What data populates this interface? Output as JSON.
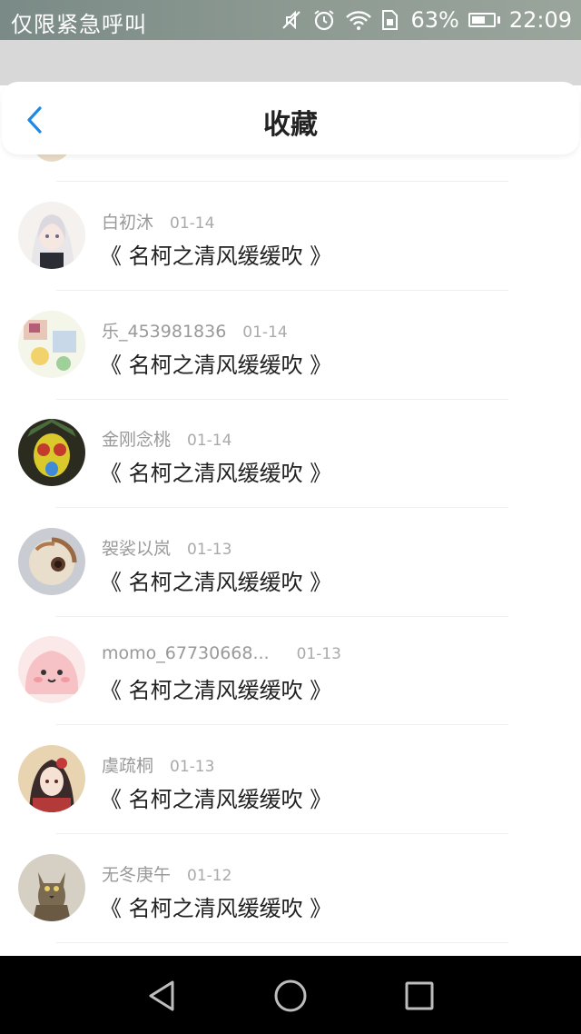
{
  "status_bar": {
    "carrier": "仅限紧急呼叫",
    "battery": "63%",
    "battery_level": 0.63,
    "time": "22:09",
    "icons": [
      "mute-icon",
      "alarm-icon",
      "wifi-icon",
      "sim-icon",
      "battery-icon"
    ]
  },
  "header": {
    "title": "收藏",
    "back_icon": "chevron-left-icon",
    "accent": "#1e88e5"
  },
  "favorites": [
    {
      "user": "白初沐",
      "date": "01-14",
      "work": "《 名柯之清风缓缓吹 》"
    },
    {
      "user": "乐_453981836",
      "date": "01-14",
      "work": "《 名柯之清风缓缓吹 》"
    },
    {
      "user": "金刚念桃",
      "date": "01-14",
      "work": "《 名柯之清风缓缓吹 》"
    },
    {
      "user": "袈裟以岚",
      "date": "01-13",
      "work": "《 名柯之清风缓缓吹 》"
    },
    {
      "user": "momo_67730668...",
      "date": "01-13",
      "work": "《 名柯之清风缓缓吹 》"
    },
    {
      "user": "虞疏桐",
      "date": "01-13",
      "work": "《 名柯之清风缓缓吹 》"
    },
    {
      "user": "无冬庚午",
      "date": "01-12",
      "work": "《 名柯之清风缓缓吹 》"
    }
  ],
  "nav_bar": {
    "buttons": [
      "back-triangle-icon",
      "home-circle-icon",
      "recents-square-icon"
    ]
  }
}
